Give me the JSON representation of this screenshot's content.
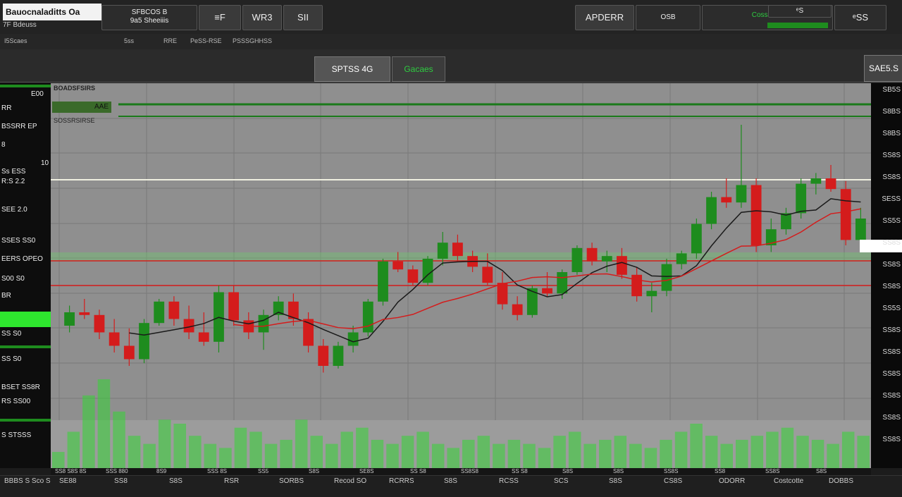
{
  "top_bar": {
    "title": "Bauocnaladitts Oa",
    "sub_title": "7F   Bdeuss",
    "btn1_line1": "SFBCOS B",
    "btn1_line2": "9a5 Sheeiiis",
    "btn2": "≡F",
    "btn3": "WR3",
    "btn4": "SII",
    "btn5": "APDERR",
    "btn6": "OSB",
    "btn7": "Cossesae",
    "btn8": "ᵉS",
    "btn9": "ᵉSS"
  },
  "sub_bar": {
    "items": [
      "I5Scaes",
      "5ss",
      "RRE",
      "PeSS-RSE",
      "PSSSGHHSS"
    ]
  },
  "toolbar": {
    "pill1": "SPTSS 4G",
    "pill2": "Gacaes",
    "pill3": "SAE5.S"
  },
  "chart": {
    "title": "BOADSFSIRS",
    "legend1": "AAE",
    "legend2": "SOSSRSIRSE"
  },
  "left_axis": [
    {
      "label": "E00"
    },
    {
      "label": "RR"
    },
    {
      "label": "BSSRR  EP"
    },
    {
      "label": "8"
    },
    {
      "label": "10"
    },
    {
      "label": "Ss ESS"
    },
    {
      "label": "R:S    2.2"
    },
    {
      "label": "SEE    2.0"
    },
    {
      "label": "SSES    SS0"
    },
    {
      "label": "EERS OPEO"
    },
    {
      "label": "S00   S0"
    },
    {
      "label": "BR"
    },
    {
      "label": "SS    S0"
    },
    {
      "label": "SS    S0"
    },
    {
      "label": "BSET SS8R"
    },
    {
      "label": "RS    SS00"
    },
    {
      "label": "S    STSSS"
    }
  ],
  "right_axis": [
    "SB5S",
    "S8BS",
    "S8BS",
    "SS8S",
    "SS8S",
    "SESS",
    "SS5S",
    "SS8S",
    "SS8S",
    "SS8S",
    "SS5S",
    "SS8S",
    "SS8S",
    "SS8S",
    "SS8S",
    "SS8S",
    "SS8S"
  ],
  "bottom_axis": [
    "SS8 S8S 8S",
    "SSS 880",
    "8S9",
    "SSS 8S",
    "SS5",
    "S8S",
    "SE8S",
    "SS S8",
    "SS8S8",
    "SS S8",
    "S8S",
    "S8S",
    "SS8S",
    "SS8",
    "SS8S",
    "S8S"
  ],
  "status_bar": {
    "items": [
      "BBBS S  Sco S",
      "SE88",
      "SS8",
      "S8S",
      "RSR",
      "SORBS",
      "Recod SO",
      "RCRRS",
      "S8S",
      "RCSS",
      "SCS",
      "S8S",
      "CS8S",
      "ODORR",
      "Costcotte",
      "DOBBS"
    ]
  },
  "colors": {
    "bull": "#1e8c1e",
    "bear": "#d41c1c",
    "grid": "#7a7a7a",
    "chart_bg": "#8f8f8f",
    "volume": "#34d634"
  },
  "price_series": [
    {
      "o": 40,
      "h": 55,
      "l": 35,
      "c": 50
    },
    {
      "o": 50,
      "h": 60,
      "l": 45,
      "c": 48
    },
    {
      "o": 48,
      "h": 52,
      "l": 30,
      "c": 35
    },
    {
      "o": 35,
      "h": 45,
      "l": 20,
      "c": 25
    },
    {
      "o": 25,
      "h": 38,
      "l": 10,
      "c": 15
    },
    {
      "o": 15,
      "h": 45,
      "l": 12,
      "c": 42
    },
    {
      "o": 42,
      "h": 60,
      "l": 40,
      "c": 58
    },
    {
      "o": 58,
      "h": 62,
      "l": 40,
      "c": 45
    },
    {
      "o": 45,
      "h": 55,
      "l": 30,
      "c": 35
    },
    {
      "o": 35,
      "h": 50,
      "l": 25,
      "c": 28
    },
    {
      "o": 28,
      "h": 70,
      "l": 20,
      "c": 65
    },
    {
      "o": 65,
      "h": 70,
      "l": 40,
      "c": 44
    },
    {
      "o": 44,
      "h": 50,
      "l": 30,
      "c": 35
    },
    {
      "o": 35,
      "h": 52,
      "l": 22,
      "c": 48
    },
    {
      "o": 48,
      "h": 62,
      "l": 44,
      "c": 58
    },
    {
      "o": 58,
      "h": 64,
      "l": 40,
      "c": 45
    },
    {
      "o": 45,
      "h": 50,
      "l": 20,
      "c": 25
    },
    {
      "o": 25,
      "h": 30,
      "l": 5,
      "c": 10
    },
    {
      "o": 10,
      "h": 28,
      "l": 8,
      "c": 25
    },
    {
      "o": 25,
      "h": 40,
      "l": 20,
      "c": 35
    },
    {
      "o": 35,
      "h": 60,
      "l": 32,
      "c": 58
    },
    {
      "o": 58,
      "h": 90,
      "l": 55,
      "c": 88
    },
    {
      "o": 88,
      "h": 95,
      "l": 80,
      "c": 82
    },
    {
      "o": 82,
      "h": 85,
      "l": 70,
      "c": 72
    },
    {
      "o": 72,
      "h": 92,
      "l": 70,
      "c": 90
    },
    {
      "o": 90,
      "h": 110,
      "l": 85,
      "c": 102
    },
    {
      "o": 102,
      "h": 108,
      "l": 88,
      "c": 92
    },
    {
      "o": 92,
      "h": 96,
      "l": 80,
      "c": 84
    },
    {
      "o": 84,
      "h": 94,
      "l": 70,
      "c": 72
    },
    {
      "o": 72,
      "h": 80,
      "l": 52,
      "c": 56
    },
    {
      "o": 56,
      "h": 62,
      "l": 44,
      "c": 48
    },
    {
      "o": 48,
      "h": 70,
      "l": 46,
      "c": 68
    },
    {
      "o": 68,
      "h": 80,
      "l": 62,
      "c": 64
    },
    {
      "o": 64,
      "h": 82,
      "l": 60,
      "c": 80
    },
    {
      "o": 80,
      "h": 100,
      "l": 78,
      "c": 98
    },
    {
      "o": 98,
      "h": 102,
      "l": 85,
      "c": 88
    },
    {
      "o": 88,
      "h": 96,
      "l": 80,
      "c": 92
    },
    {
      "o": 92,
      "h": 98,
      "l": 75,
      "c": 78
    },
    {
      "o": 78,
      "h": 84,
      "l": 58,
      "c": 62
    },
    {
      "o": 62,
      "h": 72,
      "l": 50,
      "c": 66
    },
    {
      "o": 66,
      "h": 90,
      "l": 62,
      "c": 86
    },
    {
      "o": 86,
      "h": 96,
      "l": 82,
      "c": 94
    },
    {
      "o": 94,
      "h": 120,
      "l": 90,
      "c": 116
    },
    {
      "o": 116,
      "h": 140,
      "l": 112,
      "c": 136
    },
    {
      "o": 136,
      "h": 150,
      "l": 128,
      "c": 132
    },
    {
      "o": 132,
      "h": 190,
      "l": 128,
      "c": 145
    },
    {
      "o": 145,
      "h": 150,
      "l": 95,
      "c": 100
    },
    {
      "o": 100,
      "h": 120,
      "l": 95,
      "c": 112
    },
    {
      "o": 112,
      "h": 128,
      "l": 108,
      "c": 124
    },
    {
      "o": 124,
      "h": 150,
      "l": 120,
      "c": 146
    },
    {
      "o": 146,
      "h": 154,
      "l": 138,
      "c": 150
    },
    {
      "o": 150,
      "h": 160,
      "l": 140,
      "c": 142
    },
    {
      "o": 142,
      "h": 148,
      "l": 100,
      "c": 104
    },
    {
      "o": 104,
      "h": 128,
      "l": 98,
      "c": 120
    }
  ],
  "volume_series": [
    20,
    45,
    90,
    110,
    70,
    40,
    30,
    60,
    55,
    40,
    30,
    25,
    50,
    45,
    30,
    35,
    60,
    40,
    30,
    45,
    50,
    35,
    30,
    40,
    45,
    30,
    25,
    35,
    40,
    30,
    35,
    30,
    25,
    40,
    45,
    30,
    35,
    40,
    30,
    25,
    35,
    45,
    55,
    40,
    30,
    35,
    40,
    45,
    50,
    40,
    35,
    30,
    45,
    40
  ]
}
